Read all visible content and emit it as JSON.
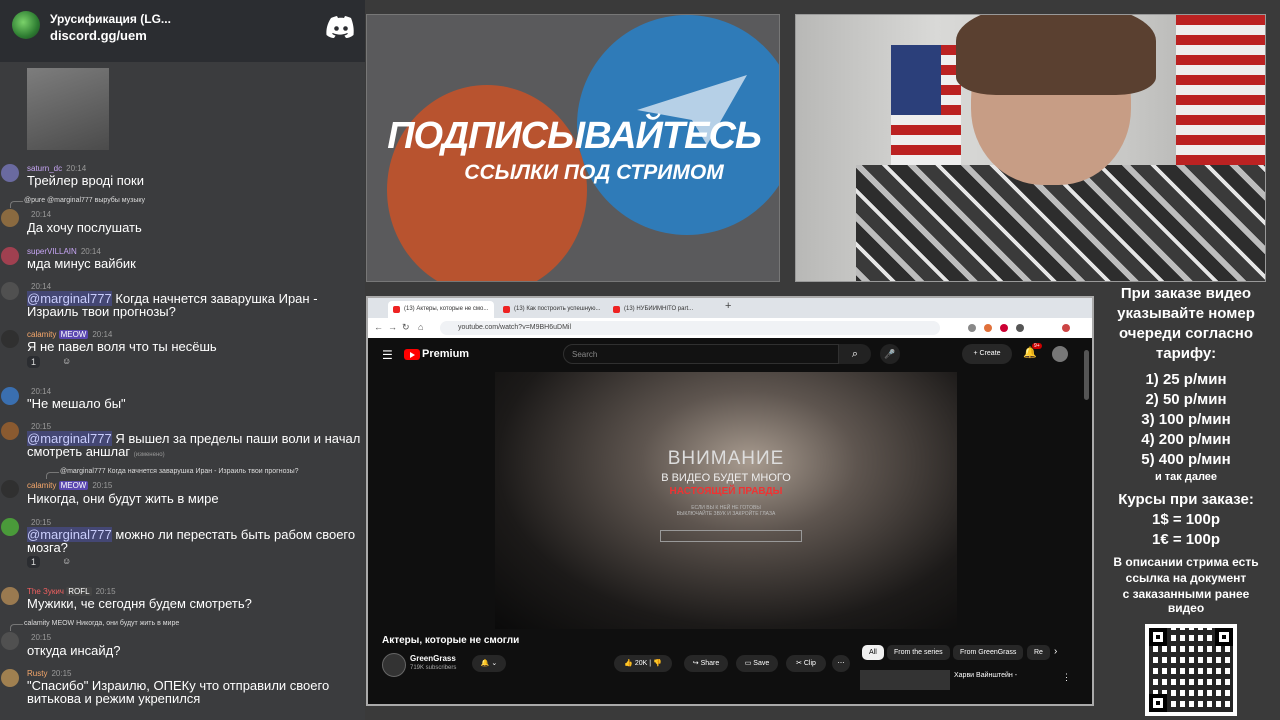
{
  "discord": {
    "server_name": "Урусификация (LG...",
    "invite": "discord.gg/uem"
  },
  "chat": [
    {
      "user": "saturn_dc",
      "time": "20:14",
      "text": "Трейлер вроді поки"
    },
    {
      "reply": "@pure @marginal777 вырубы музыку",
      "user": "",
      "time": "20:14",
      "text": "Да хочу послушать"
    },
    {
      "user": "superVILLAIN",
      "time": "20:14",
      "text": "мда минус вайбик"
    },
    {
      "user": "",
      "time": "20:14",
      "mention": "@marginal777",
      "text": "Когда начнется заварушка Иран - Израиль твои прогнозы?"
    },
    {
      "user": "calamity",
      "tag": "MEOW",
      "time": "20:14",
      "text": "Я не павел воля что ты несёшь",
      "reaction": "1"
    },
    {
      "user": "",
      "time": "20:14",
      "text": "\"Не мешало бы\""
    },
    {
      "user": "",
      "time": "20:15",
      "mention": "@marginal777",
      "text": "Я вышел за пределы паши воли и начал смотреть аншлаг",
      "edited": "(изменено)"
    },
    {
      "reply": "@marginal777 Когда начнется заварушка Иран - Израиль твои прогнозы?",
      "user": "calamity",
      "tag": "MEOW",
      "time": "20:15",
      "text": "Никогда, они будут жить в мире"
    },
    {
      "user": "",
      "time": "20:15",
      "mention": "@marginal777",
      "text": "можно ли перестать быть рабом своего мозга?",
      "reaction": "1"
    },
    {
      "user": "The Зукич",
      "tag": "ROFL",
      "time": "20:15",
      "text": "Мужики, че сегодня будем смотреть?"
    },
    {
      "reply": "calamity MEOW Никогда, они будут жить в мире",
      "user": "",
      "time": "20:15",
      "text": "откуда инсайд?"
    },
    {
      "user": "Rusty",
      "time": "20:15",
      "text": "\"Спасибо\" Израилю, ОПЕКу что отправили своего витькова и режим укрепился"
    }
  ],
  "banner": {
    "line1": "ПОДПИСЫВАЙТЕСЬ",
    "line2": "ССЫЛКИ ПОД СТРИМОМ"
  },
  "browser": {
    "tabs": [
      "(13) Актеры, которые не смо...",
      "(13) Как построить успешную...",
      "(13) НУБИИМНІТО part..."
    ],
    "url": "youtube.com/watch?v=M9BH6uDMil",
    "brand": "Premium",
    "search_placeholder": "Search",
    "create_label": "Create",
    "notif_count": "9+",
    "video_overlay": {
      "l1": "ВНИМАНИЕ",
      "l2": "В ВИДЕО БУДЕТ МНОГО",
      "l3": "НАСТОЯЩЕЙ ПРАВДЫ",
      "l4": "ЕСЛИ ВЫ К НЕЙ НЕ ГОТОВЫ",
      "l5": "ВЫКЛЮЧАЙТЕ ЗВУК И ЗАКРОЙТЕ ГЛАЗА"
    },
    "video_title": "Актеры, которые не смогли",
    "channel": "GreenGrass",
    "subs": "719K subscribers",
    "likes": "20K",
    "share": "Share",
    "save": "Save",
    "clip": "Clip",
    "chips": [
      "All",
      "From the series",
      "From GreenGrass",
      "Re"
    ],
    "rec_title": "Харви Вайнштейн -"
  },
  "side": {
    "lines": [
      "При заказе видео",
      "указывайте номер",
      "очереди согласно",
      "тарифу:"
    ],
    "tariffs": [
      "1) 25 р/мин",
      "2) 50 р/мин",
      "3) 100 р/мин",
      "4) 200 р/мин",
      "5) 400 р/мин"
    ],
    "etc": "и так далее",
    "rates_title": "Курсы при заказе:",
    "rates": [
      "1$ = 100р",
      "1€ = 100р"
    ],
    "note": [
      "В описании стрима есть",
      "ссылка на документ",
      "с заказанными ранее",
      "видео"
    ]
  }
}
